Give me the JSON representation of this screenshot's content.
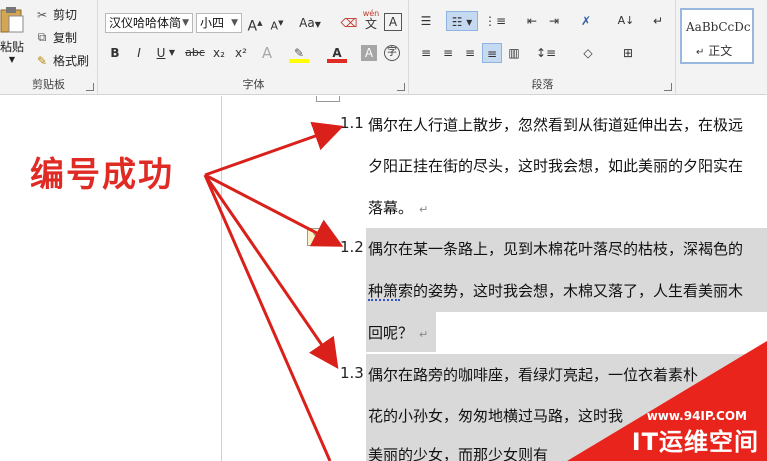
{
  "ribbon": {
    "clipboard": {
      "paste_label": "粘贴",
      "cut_label": "剪切",
      "copy_label": "复制",
      "format_painter_label": "格式刷",
      "group_label": "剪贴板"
    },
    "font": {
      "font_name": "汉仪哈哈体简",
      "font_size": "小四",
      "grow_label": "A",
      "shrink_label": "A",
      "case_label": "Aa",
      "phonetic_label": "wén",
      "phonetic_char": "文",
      "border_char": "A",
      "bold": "B",
      "italic": "I",
      "underline": "U",
      "strike": "abc",
      "subscript": "x₂",
      "superscript": "x²",
      "group_label": "字体"
    },
    "paragraph": {
      "group_label": "段落"
    },
    "styles": {
      "sample": "AaBbCcDc",
      "normal_label": "正文"
    }
  },
  "document": {
    "items": [
      {
        "number": "1.1",
        "lines": [
          "偶尔在人行道上散步，忽然看到从街道延伸出去，在极远",
          "夕阳正挂在街的尽头，这时我会想，如此美丽的夕阳实在",
          "落幕。"
        ]
      },
      {
        "number": "1.2",
        "lines": [
          "偶尔在某一条路上，见到木棉花叶落尽的枯枝，深褐色的",
          "种箫索的姿势，这时我会想，木棉又落了，人生看美丽木",
          "回呢？"
        ]
      },
      {
        "number": "1.3",
        "lines": [
          "偶尔在路旁的咖啡座，看绿灯亮起，一位衣着素朴",
          "花的小孙女，匆匆地横过马路，这时我",
          "美丽的少女，而那少女则有"
        ]
      }
    ]
  },
  "annotation": {
    "text": "编号成功"
  },
  "watermark": {
    "url": "www.94IP.COM",
    "title": "IT运维空间"
  },
  "colors": {
    "annotation_red": "#e02a24",
    "arrow_red": "#d9201a",
    "highlight_gray": "#d9d9d9",
    "ribbon_bg": "#f3f3f3"
  }
}
